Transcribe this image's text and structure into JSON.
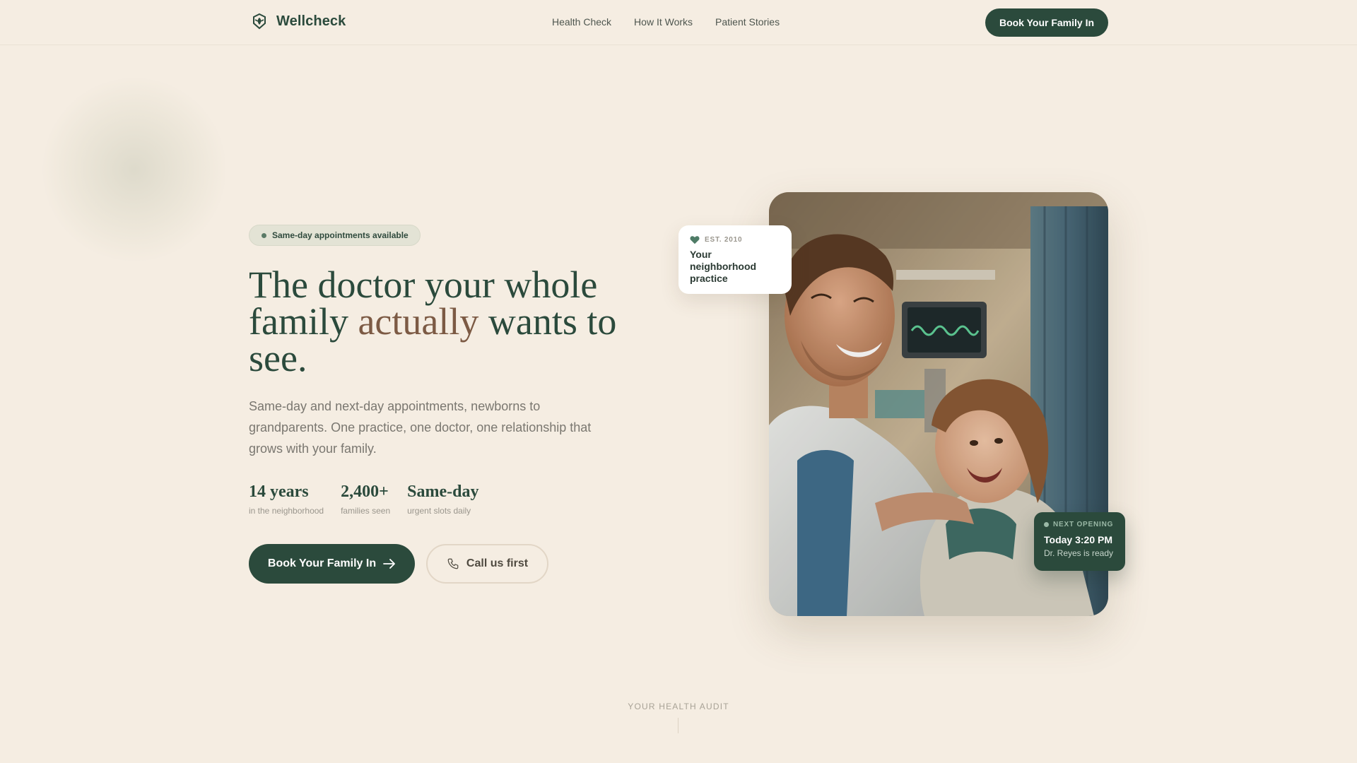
{
  "nav": {
    "brand": "Wellcheck",
    "links": [
      "Health Check",
      "How It Works",
      "Patient Stories"
    ],
    "cta": "Book Your Family In"
  },
  "hero": {
    "badge": "Same-day appointments available",
    "headline_before": "The doctor your whole family ",
    "headline_accent": "actually",
    "headline_after": " wants to see.",
    "subtext": "Same-day and next-day appointments, newborns to grandparents. One practice, one doctor, one relationship that grows with your family.",
    "stats": [
      {
        "value": "14 years",
        "label": "in the neighborhood"
      },
      {
        "value": "2,400+",
        "label": "families seen"
      },
      {
        "value": "Same-day",
        "label": "urgent slots daily"
      }
    ],
    "primary_cta": "Book Your Family In",
    "secondary_cta": "Call us first"
  },
  "est_card": {
    "label": "EST. 2010",
    "title": "Your neighborhood practice",
    "icon": "heart-icon"
  },
  "next_card": {
    "label": "NEXT OPENING",
    "time": "Today 3:20 PM",
    "doctor": "Dr. Reyes is ready"
  },
  "section": {
    "label": "YOUR HEALTH AUDIT"
  },
  "colors": {
    "background": "#f5ede2",
    "primary": "#2b4a3c",
    "accent": "#7c5a44"
  }
}
